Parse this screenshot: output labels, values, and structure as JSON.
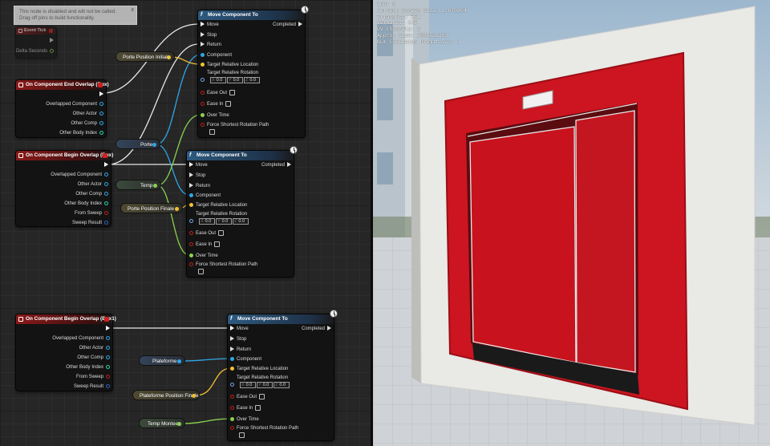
{
  "disabled_note": {
    "line1": "This node is disabled and will not be called.",
    "line2": "Drag off pins to build functionality.",
    "close": "x"
  },
  "event_tick": {
    "title": "Event Tick",
    "delta_seconds": "Delta Seconds"
  },
  "end_overlap_box": {
    "title": "On Component End Overlap (Box)",
    "pins": [
      "Overlapped Component",
      "Other Actor",
      "Other Comp",
      "Other Body Index"
    ]
  },
  "begin_overlap_box": {
    "title": "On Component Begin Overlap (Box)",
    "pins": [
      "Overlapped Component",
      "Other Actor",
      "Other Comp",
      "Other Body Index",
      "From Sweep",
      "Sweep Result"
    ]
  },
  "begin_overlap_box1": {
    "title": "On Component Begin Overlap (Box1)",
    "pins": [
      "Overlapped Component",
      "Other Actor",
      "Other Comp",
      "Other Body Index",
      "From Sweep",
      "Sweep Result"
    ]
  },
  "move_component": {
    "title": "Move Component To",
    "move": "Move",
    "stop": "Stop",
    "return": "Return",
    "completed": "Completed",
    "component": "Component",
    "target_location": "Target Relative Location",
    "target_rotation": "Target Relative Rotation",
    "axis_x": "X",
    "axis_y": "Y",
    "axis_z": "Z",
    "value": "0.0",
    "ease_out": "Ease Out",
    "ease_in": "Ease In",
    "over_time": "Over Time",
    "force_shortest": "Force Shortest Rotation Path"
  },
  "variables": {
    "porte_position_initiale": "Porte Position Initiale",
    "porte": "Porte",
    "temp": "Temp",
    "porte_position_finale": "Porte Position Finale",
    "plateforme": "Plateforme",
    "plateforme_position_finale": "Plateforme Position Finale",
    "temp_montee": "Temp Montee"
  },
  "viewport_stats": [
    "LOD:  0",
    "Current Screen Size:  1.070204",
    "Triangles:  364",
    "Vertices:  445",
    "UV Channels:  2",
    "Approx Size: 300x52x303",
    "Num Collision Primitives:  1"
  ],
  "colors": {
    "exec": "#ffffff",
    "object": "#2fa7e6",
    "vector": "#f1c232",
    "rotator": "#6ea6e6",
    "bool": "#9b1010",
    "float": "#8bd24e",
    "int": "#2ad1a8",
    "struct": "#2c63b8",
    "door_red": "#cc1520",
    "wall": "#e9e9e6"
  }
}
